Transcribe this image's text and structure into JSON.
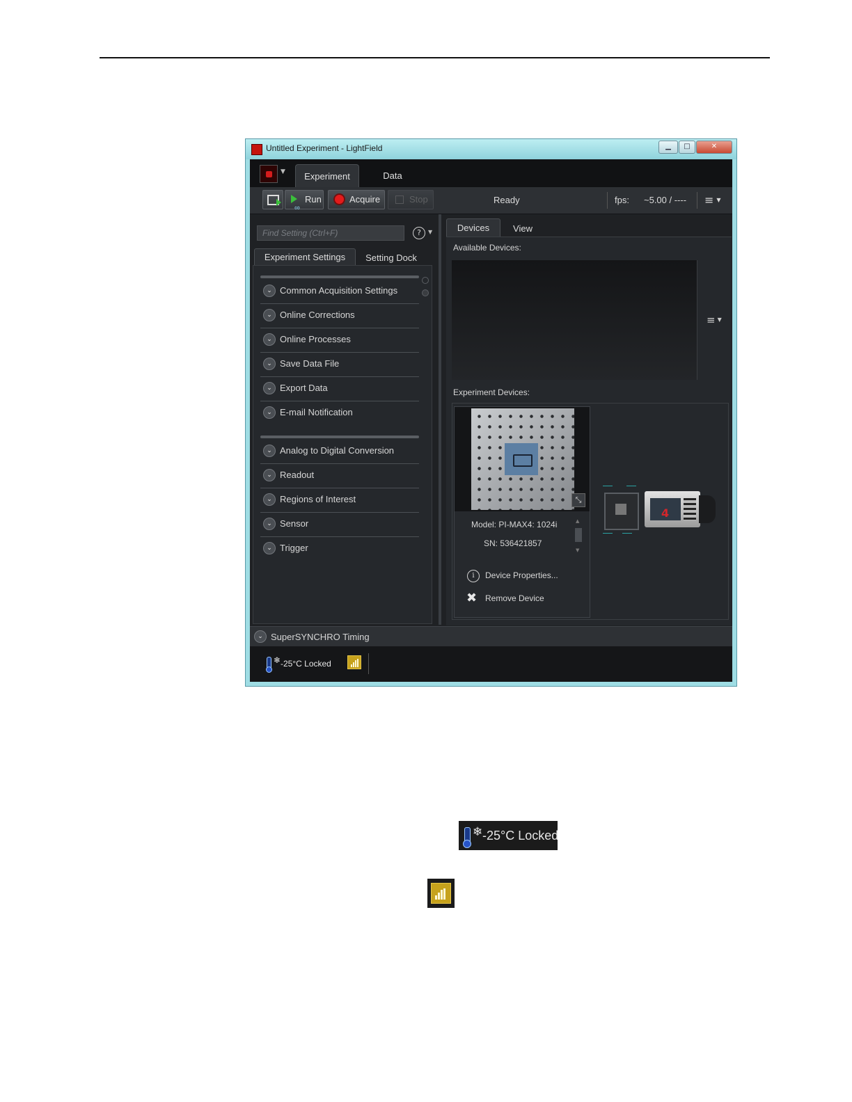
{
  "window": {
    "title": "Untitled Experiment - LightField",
    "controls": [
      "minimize",
      "maximize",
      "close"
    ]
  },
  "ribbon": {
    "tabs": [
      "Experiment",
      "Data"
    ]
  },
  "toolbar": {
    "run_label": "Run",
    "acquire_label": "Acquire",
    "stop_label": "Stop",
    "status": "Ready",
    "fps_label": "fps:",
    "fps_value": "~5.00 / ----"
  },
  "left_panel": {
    "search_placeholder": "Find Setting (Ctrl+F)",
    "tabs": [
      "Experiment Settings",
      "Setting Dock"
    ],
    "group1": [
      "Common Acquisition Settings",
      "Online Corrections",
      "Online Processes",
      "Save Data File",
      "Export Data",
      "E-mail Notification"
    ],
    "group2": [
      "Analog to Digital Conversion",
      "Readout",
      "Regions of Interest",
      "Sensor",
      "Trigger"
    ]
  },
  "right_panel": {
    "tabs": [
      "Devices",
      "View"
    ],
    "available_label": "Available Devices:",
    "experiment_label": "Experiment Devices:",
    "device": {
      "model": "Model:   PI-MAX4: 1024i",
      "sn": "SN: 536421857",
      "properties": "Device Properties...",
      "remove": "Remove Device"
    }
  },
  "bottom": {
    "supersynchro": "SuperSYNCHRO Timing",
    "temp_status": "-25°C Locked"
  },
  "callouts": {
    "temp_status": "-25°C Locked"
  },
  "colors": {
    "app_background": "#1f2124",
    "titlebar": "#9fdde4",
    "signal_icon": "#c7a21c",
    "acquire_dot": "#e31b1b"
  },
  "icons": [
    "app-icon",
    "preview-icon",
    "run-icon",
    "acquire-icon",
    "stop-icon",
    "menu-icon",
    "help-icon",
    "chevron-down-icon",
    "info-icon",
    "close-icon",
    "thermometer-icon",
    "snowflake-icon",
    "signal-icon",
    "expand-icon"
  ]
}
